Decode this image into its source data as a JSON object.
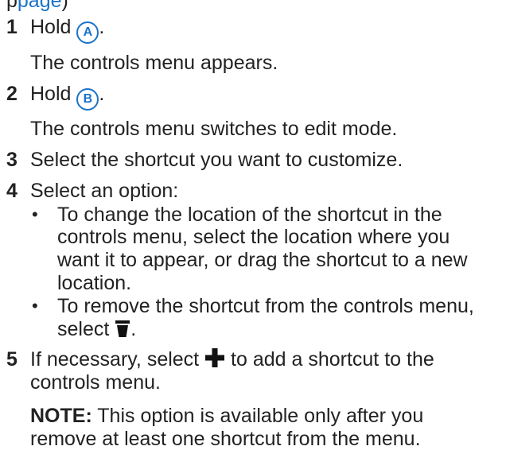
{
  "top_clipped": {
    "prefix": "p",
    "link_text": "page",
    "suffix": ")"
  },
  "steps": [
    {
      "num": "1",
      "pre": "Hold ",
      "icon_letter": "A",
      "post": ".",
      "note": "The controls menu appears."
    },
    {
      "num": "2",
      "pre": "Hold ",
      "icon_letter": "B",
      "post": ".",
      "note": "The controls menu switches to edit mode."
    },
    {
      "num": "3",
      "text": "Select the shortcut you want to customize."
    },
    {
      "num": "4",
      "text": "Select an option:",
      "bullets": [
        {
          "lines": [
            "To change the location of the shortcut in the",
            "controls menu, select the location where you",
            "want it to appear, or drag the shortcut to a new",
            "location."
          ]
        },
        {
          "line1": "To remove the shortcut from the controls menu,",
          "line2_pre": "select ",
          "line2_post": "."
        }
      ]
    },
    {
      "num": "5",
      "line1_pre": "If necessary, select ",
      "line1_post": " to add a shortcut to the",
      "line2": "controls menu."
    }
  ],
  "note": {
    "label": "NOTE:",
    "line1_rest": " This option is available only after you",
    "line2": "remove at least one shortcut from the menu."
  },
  "colors": {
    "text": "#222222",
    "accent": "#1a73c8"
  },
  "icons": {
    "trash": "trash-icon",
    "plus": "plus-icon"
  }
}
